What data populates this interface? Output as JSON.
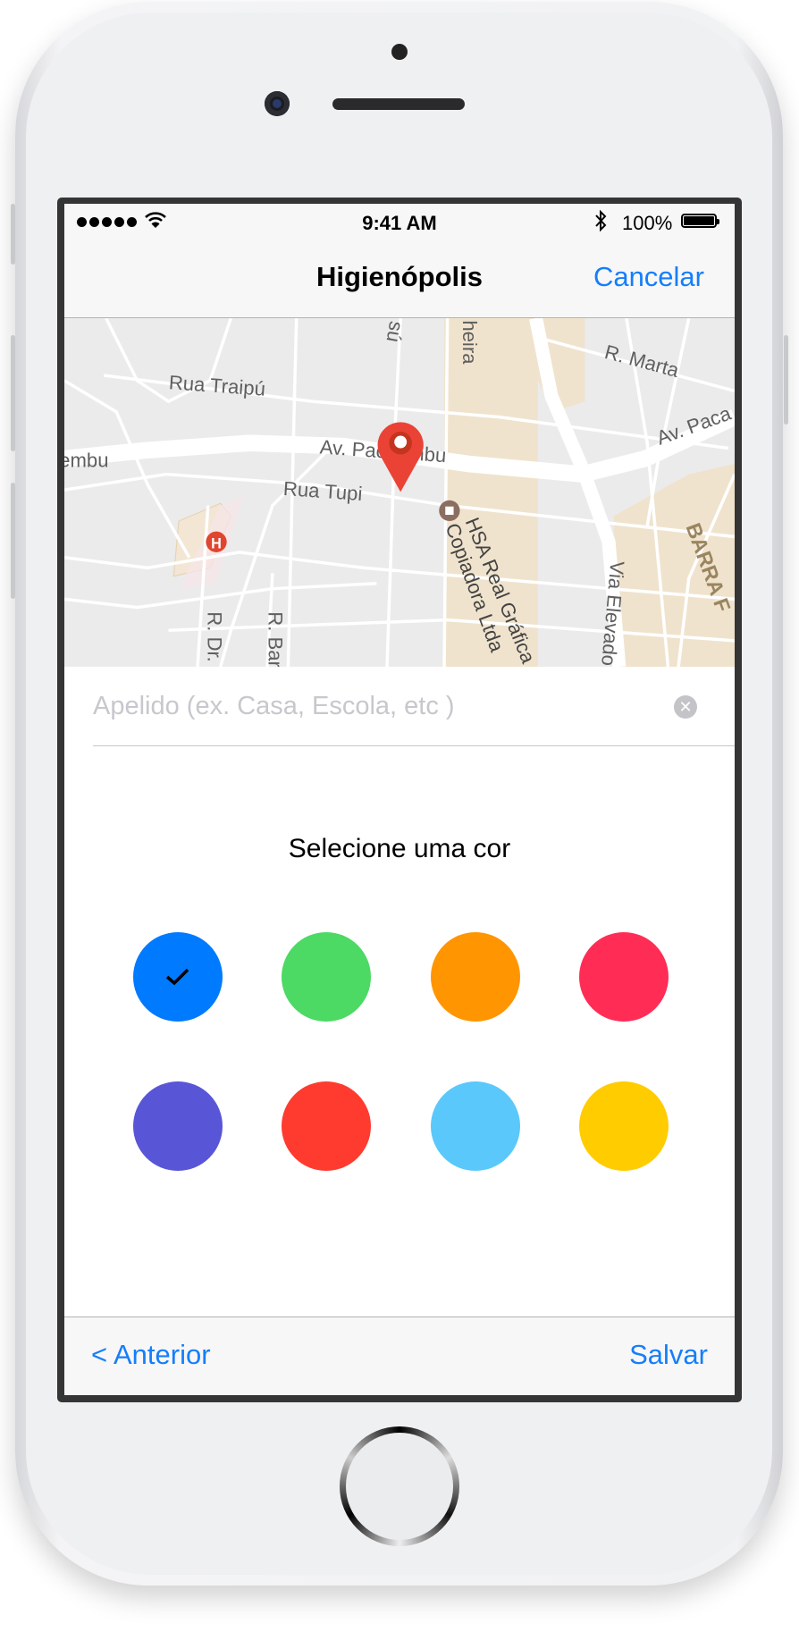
{
  "status_bar": {
    "time": "9:41 AM",
    "battery": "100%"
  },
  "nav": {
    "title": "Higienópolis",
    "cancel_label": "Cancelar"
  },
  "map": {
    "labels": {
      "rua_traipu": "Rua Traipú",
      "av_pacaembu": "Av. Pacaembu",
      "embu": "embu",
      "av_paca": "Av. Paca",
      "rua_tupi": "Rua Tupi",
      "r_marta": "R. Marta",
      "su": "sú",
      "heira": "heira",
      "hsa": "HSA Real Gráfica",
      "copiadora": "Copiadora Ltda",
      "via_elevado": "Via Elevado",
      "barra": "BARRA F",
      "r_dr": "R. Dr.",
      "r_bar": "R. Bar",
      "hospital_letter": "H"
    },
    "pin_color": "#ea4335"
  },
  "form": {
    "nickname_placeholder": "Apelido (ex. Casa, Escola, etc )",
    "nickname_value": ""
  },
  "colors": {
    "title": "Selecione uma cor",
    "options": [
      {
        "name": "blue",
        "hex": "#007aff",
        "selected": true
      },
      {
        "name": "green",
        "hex": "#4cd964",
        "selected": false
      },
      {
        "name": "orange",
        "hex": "#ff9500",
        "selected": false
      },
      {
        "name": "pink",
        "hex": "#ff2d55",
        "selected": false
      },
      {
        "name": "purple",
        "hex": "#5856d6",
        "selected": false
      },
      {
        "name": "red",
        "hex": "#ff3b30",
        "selected": false
      },
      {
        "name": "light-blue",
        "hex": "#5ac8fa",
        "selected": false
      },
      {
        "name": "yellow",
        "hex": "#ffcc00",
        "selected": false
      }
    ]
  },
  "toolbar": {
    "back_label": "< Anterior",
    "save_label": "Salvar"
  }
}
